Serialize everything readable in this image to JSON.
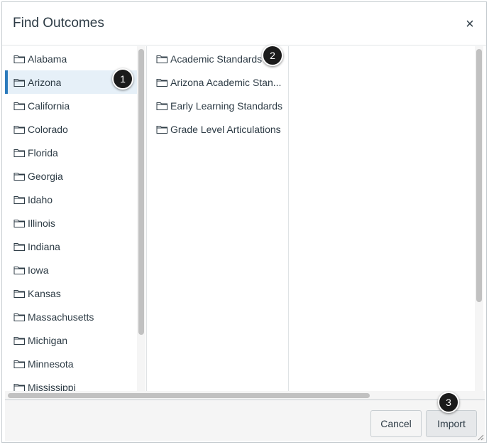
{
  "dialog": {
    "title": "Find Outcomes",
    "close_icon": "close-icon"
  },
  "states": [
    {
      "label": "Alabama",
      "selected": false
    },
    {
      "label": "Arizona",
      "selected": true
    },
    {
      "label": "California",
      "selected": false
    },
    {
      "label": "Colorado",
      "selected": false
    },
    {
      "label": "Florida",
      "selected": false
    },
    {
      "label": "Georgia",
      "selected": false
    },
    {
      "label": "Idaho",
      "selected": false
    },
    {
      "label": "Illinois",
      "selected": false
    },
    {
      "label": "Indiana",
      "selected": false
    },
    {
      "label": "Iowa",
      "selected": false
    },
    {
      "label": "Kansas",
      "selected": false
    },
    {
      "label": "Massachusetts",
      "selected": false
    },
    {
      "label": "Michigan",
      "selected": false
    },
    {
      "label": "Minnesota",
      "selected": false
    },
    {
      "label": "Mississippi",
      "selected": false
    }
  ],
  "groups": [
    {
      "label": "Academic Standards"
    },
    {
      "label": "Arizona Academic Stan..."
    },
    {
      "label": "Early Learning Standards"
    },
    {
      "label": "Grade Level Articulations"
    }
  ],
  "footer": {
    "cancel_label": "Cancel",
    "import_label": "Import"
  },
  "callouts": [
    "1",
    "2",
    "3"
  ],
  "colors": {
    "selected_bg": "#e6f0f8",
    "selected_accent": "#2b7abc",
    "text": "#2d3b45"
  }
}
